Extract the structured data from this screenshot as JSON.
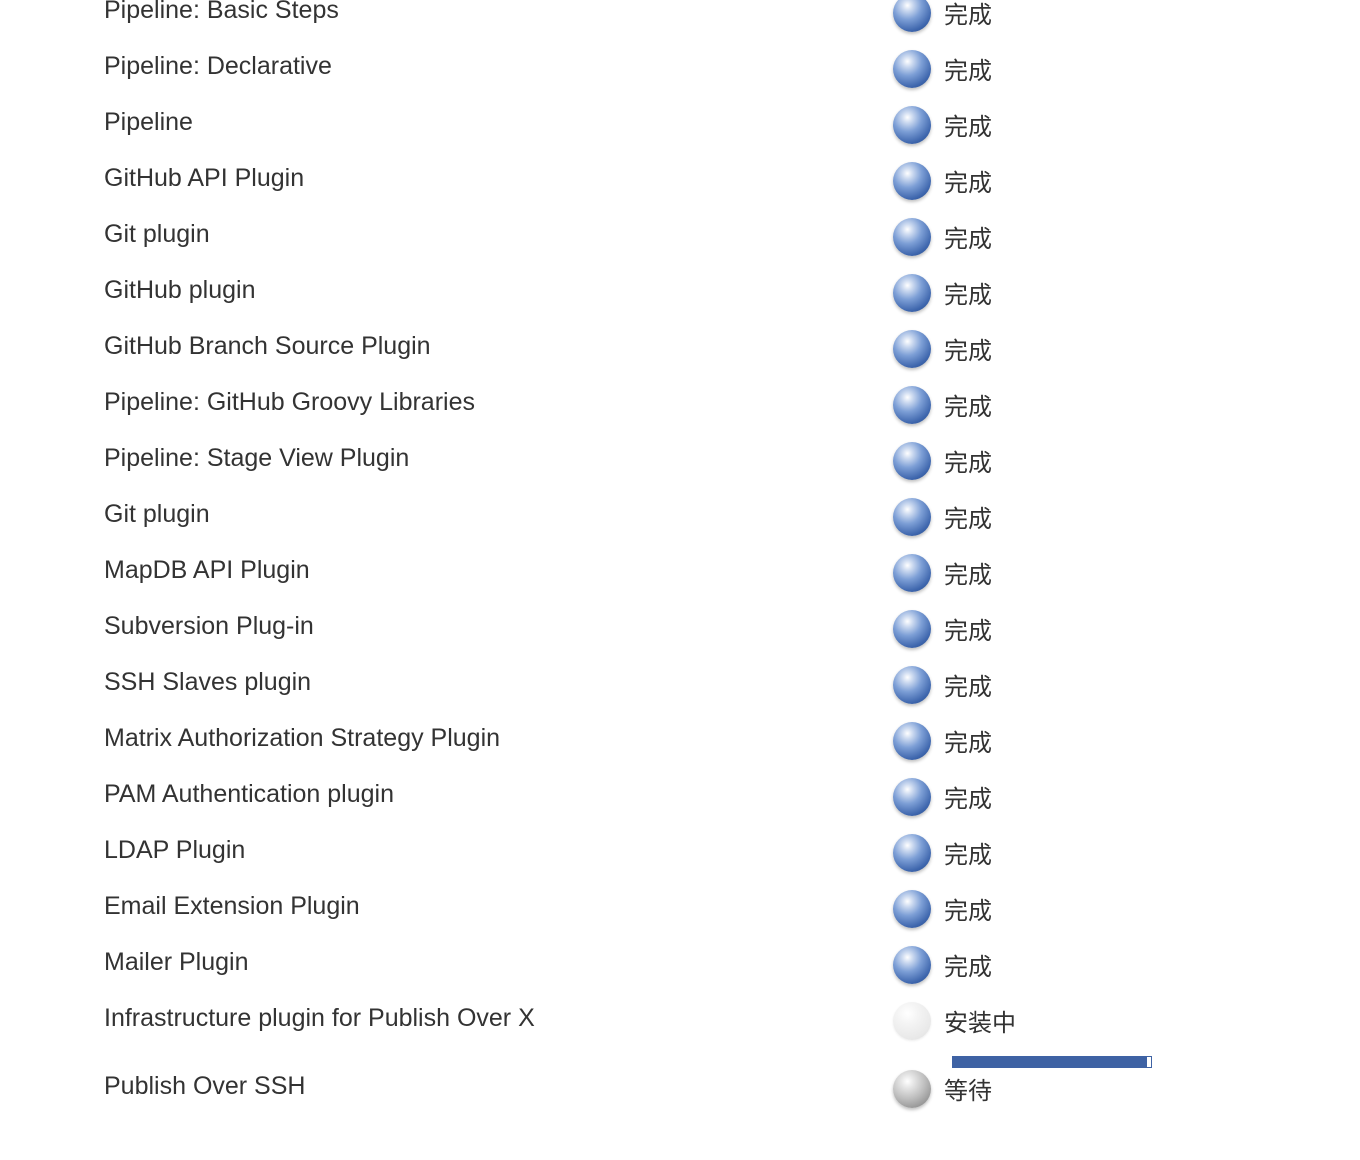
{
  "plugins": [
    {
      "name": "Pipeline: Basic Steps",
      "status": "完成",
      "state": "done"
    },
    {
      "name": "Pipeline: Declarative",
      "status": "完成",
      "state": "done"
    },
    {
      "name": "Pipeline",
      "status": "完成",
      "state": "done"
    },
    {
      "name": "GitHub API Plugin",
      "status": "完成",
      "state": "done"
    },
    {
      "name": "Git plugin",
      "status": "完成",
      "state": "done"
    },
    {
      "name": "GitHub plugin",
      "status": "完成",
      "state": "done"
    },
    {
      "name": "GitHub Branch Source Plugin",
      "status": "完成",
      "state": "done"
    },
    {
      "name": "Pipeline: GitHub Groovy Libraries",
      "status": "完成",
      "state": "done"
    },
    {
      "name": "Pipeline: Stage View Plugin",
      "status": "完成",
      "state": "done"
    },
    {
      "name": "Git plugin",
      "status": "完成",
      "state": "done"
    },
    {
      "name": "MapDB API Plugin",
      "status": "完成",
      "state": "done"
    },
    {
      "name": "Subversion Plug-in",
      "status": "完成",
      "state": "done"
    },
    {
      "name": "SSH Slaves plugin",
      "status": "完成",
      "state": "done"
    },
    {
      "name": "Matrix Authorization Strategy Plugin",
      "status": "完成",
      "state": "done"
    },
    {
      "name": "PAM Authentication plugin",
      "status": "完成",
      "state": "done"
    },
    {
      "name": "LDAP Plugin",
      "status": "完成",
      "state": "done"
    },
    {
      "name": "Email Extension Plugin",
      "status": "完成",
      "state": "done"
    },
    {
      "name": "Mailer Plugin",
      "status": "完成",
      "state": "done"
    },
    {
      "name": "Infrastructure plugin for Publish Over X",
      "status": "安装中",
      "state": "installing",
      "progress": 0.98
    },
    {
      "name": "Publish Over SSH",
      "status": "等待",
      "state": "pending"
    }
  ],
  "colors": {
    "done_ball": "#3e66ad",
    "pending_ball": "#a8a8a8",
    "progress_bar": "#3e62a4"
  },
  "icons": {
    "done": "blue-ball-icon",
    "installing": "blue-ball-anime-icon",
    "pending": "grey-ball-icon"
  }
}
